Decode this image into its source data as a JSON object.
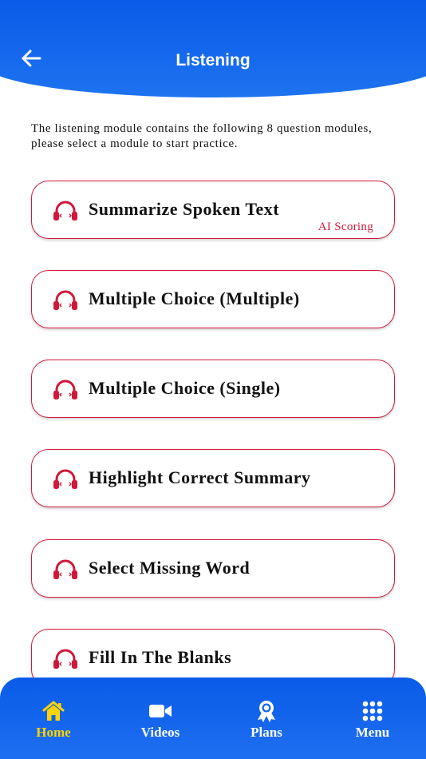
{
  "header": {
    "title": "Listening",
    "back_icon": "arrow-left-icon"
  },
  "intro": {
    "text": "The listening module contains the following 8 question modules, please select a module to start practice."
  },
  "modules": [
    {
      "label": "Summarize Spoken Text",
      "badge": "AI Scoring",
      "icon": "headphones-icon"
    },
    {
      "label": "Multiple Choice (Multiple)",
      "icon": "headphones-icon"
    },
    {
      "label": "Multiple Choice (Single)",
      "icon": "headphones-icon"
    },
    {
      "label": "Highlight Correct Summary",
      "icon": "headphones-icon"
    },
    {
      "label": "Select Missing Word",
      "icon": "headphones-icon"
    },
    {
      "label": "Fill In The Blanks",
      "icon": "headphones-icon"
    }
  ],
  "tabbar": {
    "tabs": [
      {
        "label": "Home",
        "icon": "home-icon",
        "active": true
      },
      {
        "label": "Videos",
        "icon": "video-camera-icon"
      },
      {
        "label": "Plans",
        "icon": "award-ribbon-icon"
      },
      {
        "label": "Menu",
        "icon": "grid-menu-icon"
      }
    ]
  },
  "colors": {
    "primary_blue": "#0a5be8",
    "accent_red": "#d0193a",
    "active_tab": "#ffd400",
    "text": "#111111",
    "white": "#ffffff"
  }
}
